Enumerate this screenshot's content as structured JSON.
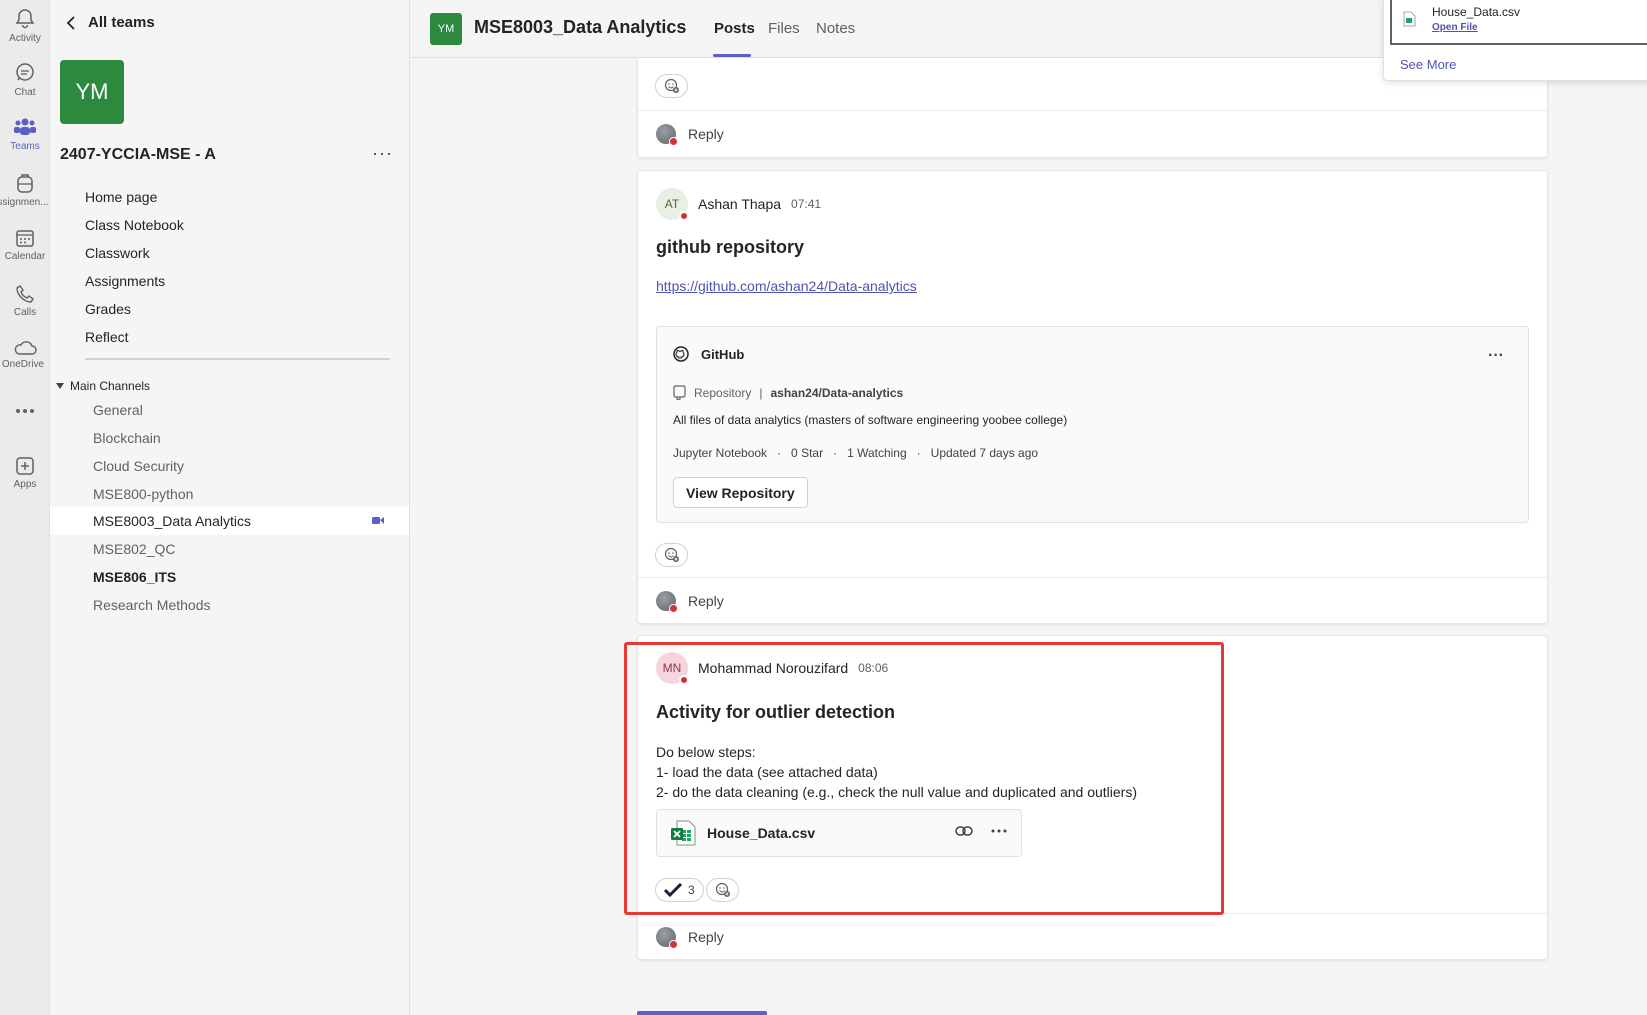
{
  "rail": {
    "items": [
      {
        "label": "Activity"
      },
      {
        "label": "Chat"
      },
      {
        "label": "Teams"
      },
      {
        "label": "ssignmen..."
      },
      {
        "label": "Calendar"
      },
      {
        "label": "Calls"
      },
      {
        "label": "OneDrive"
      },
      {
        "label": "..."
      },
      {
        "label": "Apps"
      }
    ]
  },
  "team": {
    "back_label": "All teams",
    "avatar_initials": "YM",
    "name": "2407-YCCIA-MSE - A",
    "more": "···",
    "nav": [
      "Home page",
      "Class Notebook",
      "Classwork",
      "Assignments",
      "Grades",
      "Reflect"
    ],
    "channels_heading": "Main Channels",
    "channels": [
      {
        "label": "General"
      },
      {
        "label": "Blockchain"
      },
      {
        "label": "Cloud Security"
      },
      {
        "label": "MSE800-python"
      },
      {
        "label": "MSE8003_Data Analytics"
      },
      {
        "label": "MSE802_QC"
      },
      {
        "label": "MSE806_ITS"
      },
      {
        "label": "Research Methods"
      }
    ]
  },
  "header": {
    "avatar_initials": "YM",
    "title": "MSE8003_Data Analytics",
    "tabs": [
      "Posts",
      "Files",
      "Notes"
    ]
  },
  "feed": {
    "reply_label": "Reply",
    "post1": {
      "initials": "AT",
      "author": "Ashan Thapa",
      "time": "07:41",
      "subject": "github repository",
      "link": "https://github.com/ashan24/Data-analytics",
      "card": {
        "source": "GitHub",
        "repo_label": "Repository",
        "separator": "|",
        "repo_name": "ashan24/Data-analytics",
        "description": "All files of data analytics (masters of software engineering yoobee college)",
        "meta": "Jupyter Notebook   ·   0 Star   ·   1 Watching   ·   Updated 7 days ago",
        "button": "View Repository"
      }
    },
    "post2": {
      "initials": "MN",
      "author": "Mohammad Norouzifard",
      "time": "08:06",
      "subject": "Activity for outlier detection",
      "line1": "Do below steps:",
      "line2": "1- load the data (see attached data)",
      "line3": "2- do the data cleaning (e.g., check the null value and duplicated and outliers)",
      "file_name": "House_Data.csv",
      "reaction_count": "3"
    }
  },
  "popup": {
    "file_name": "House_Data.csv",
    "open_label": "Open File",
    "see_more": "See More"
  },
  "colors": {
    "brand": "#5b5fc7",
    "team_avatar": "#2b8a3e",
    "presence_busy": "#d13438",
    "highlight": "#e53935"
  }
}
